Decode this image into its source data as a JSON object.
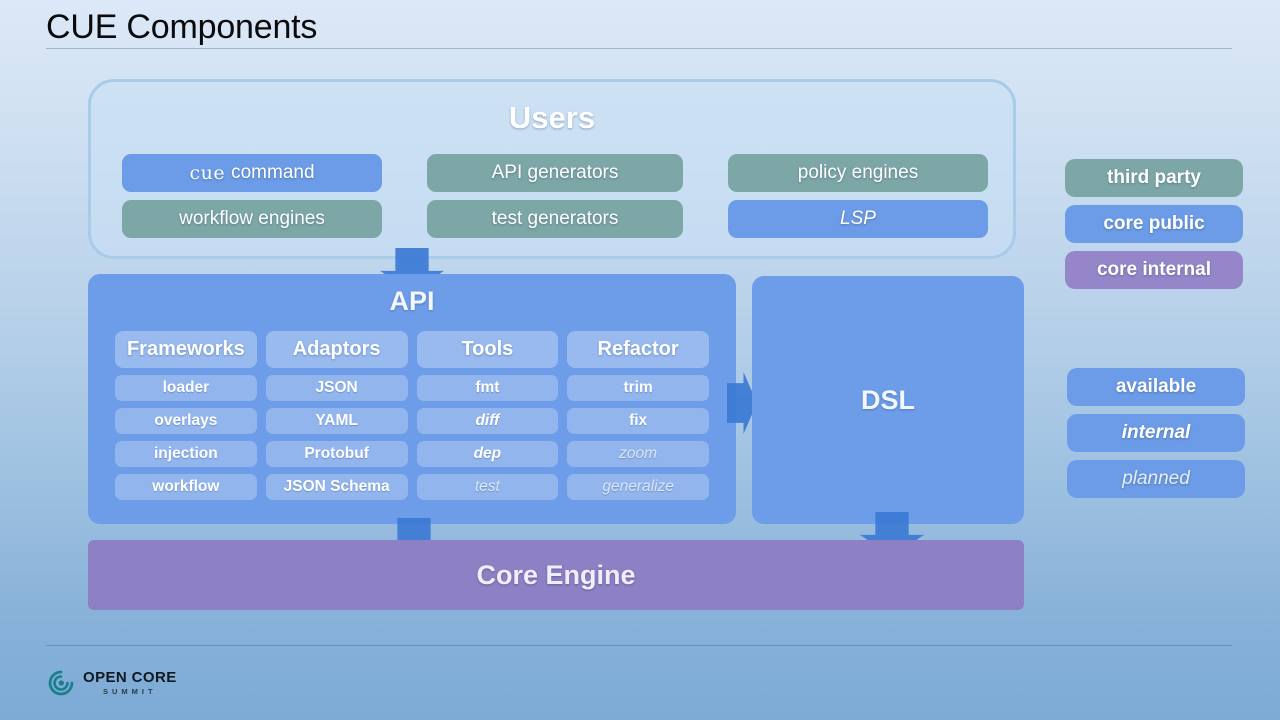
{
  "slide": {
    "title": "CUE Components"
  },
  "users": {
    "heading": "Users",
    "items": [
      {
        "label": "cue command",
        "prefix": "cue",
        "suffix": "command",
        "kind": "core-public",
        "style": "normal"
      },
      {
        "label": "API generators",
        "kind": "third-party",
        "style": "normal"
      },
      {
        "label": "policy engines",
        "kind": "third-party",
        "style": "normal"
      },
      {
        "label": "workflow engines",
        "kind": "third-party",
        "style": "normal"
      },
      {
        "label": "test generators",
        "kind": "third-party",
        "style": "normal"
      },
      {
        "label": "LSP",
        "kind": "core-public",
        "style": "italic"
      }
    ]
  },
  "api": {
    "heading": "API",
    "columns": [
      {
        "header": "Frameworks",
        "items": [
          {
            "label": "loader",
            "status": "available"
          },
          {
            "label": "overlays",
            "status": "available"
          },
          {
            "label": "injection",
            "status": "available"
          },
          {
            "label": "workflow",
            "status": "available"
          }
        ]
      },
      {
        "header": "Adaptors",
        "items": [
          {
            "label": "JSON",
            "status": "available"
          },
          {
            "label": "YAML",
            "status": "available"
          },
          {
            "label": "Protobuf",
            "status": "available"
          },
          {
            "label": "JSON Schema",
            "status": "available"
          }
        ]
      },
      {
        "header": "Tools",
        "items": [
          {
            "label": "fmt",
            "status": "available"
          },
          {
            "label": "diff",
            "status": "internal"
          },
          {
            "label": "dep",
            "status": "internal"
          },
          {
            "label": "test",
            "status": "planned"
          }
        ]
      },
      {
        "header": "Refactor",
        "items": [
          {
            "label": "trim",
            "status": "available"
          },
          {
            "label": "fix",
            "status": "available"
          },
          {
            "label": "zoom",
            "status": "planned"
          },
          {
            "label": "generalize",
            "status": "planned"
          }
        ]
      }
    ]
  },
  "dsl": {
    "label": "DSL"
  },
  "core_engine": {
    "label": "Core Engine"
  },
  "legend": {
    "audience": [
      {
        "label": "third party",
        "color": "#7da7a6"
      },
      {
        "label": "core public",
        "color": "#6c9ce8"
      },
      {
        "label": "core internal",
        "color": "#9486c8"
      }
    ],
    "status": [
      {
        "label": "available",
        "color": "#6c9ce8"
      },
      {
        "label": "internal",
        "color": "#6c9ce8"
      },
      {
        "label": "planned",
        "color": "#6c9ce8"
      }
    ]
  },
  "footer": {
    "logo_main": "OPEN CORE",
    "logo_sub": "SUMMIT"
  }
}
